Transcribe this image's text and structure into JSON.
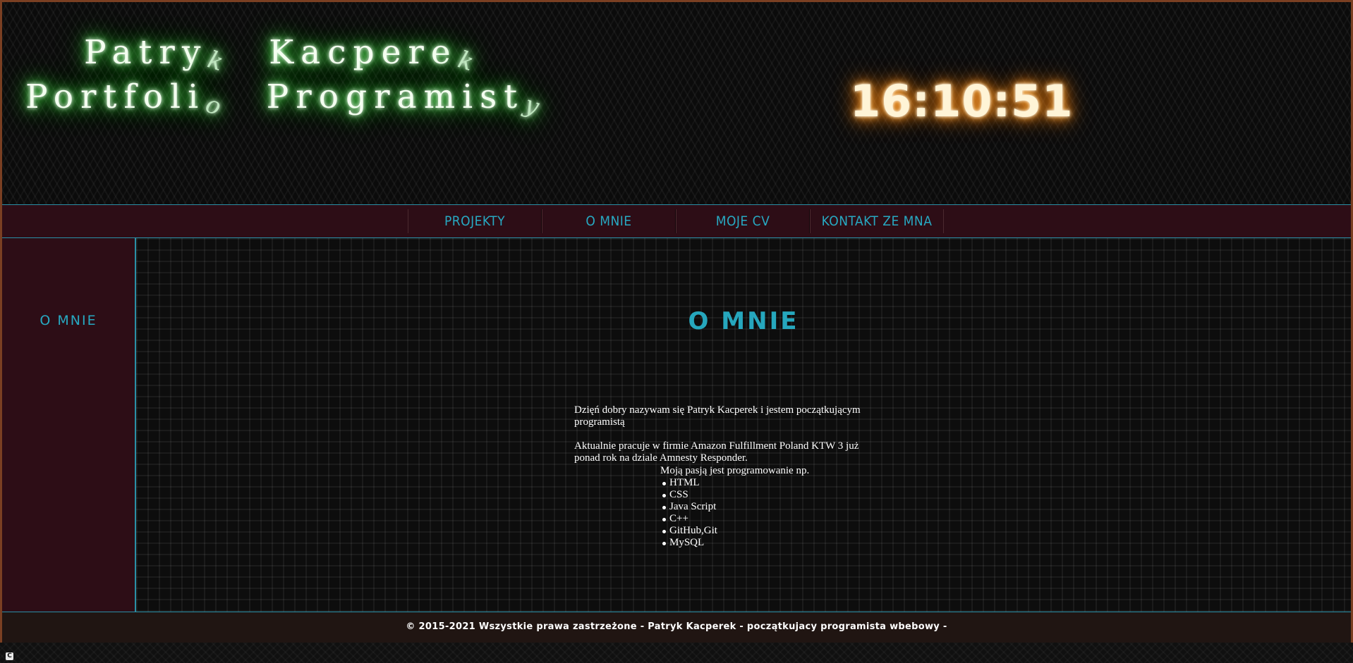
{
  "header": {
    "title_name": {
      "word1": "Patry",
      "word1_tail": "k",
      "word2": "Kacpere",
      "word2_tail": "k"
    },
    "title_role": {
      "word1": "Portfoli",
      "word1_tail": "o",
      "word2": "Programist",
      "word2_tail": "y"
    },
    "clock": "16:10:51"
  },
  "nav": {
    "items": [
      {
        "label": "PROJEKTY"
      },
      {
        "label": "O MNIE"
      },
      {
        "label": "MOJE CV"
      },
      {
        "label": "KONTAKT ZE MNA"
      }
    ]
  },
  "sidebar": {
    "item_label": "O MNIE"
  },
  "main": {
    "title": "O MNIE",
    "intro": [
      "Dzięń dobry nazywam się Patryk Kacperek i jestem początkującym programistą",
      "Aktualnie pracuje w firmie Amazon Fulfillment Poland KTW 3 już ponad rok na dziale Amnesty Responder."
    ],
    "skills_heading": "Moją pasją jest programowanie np.",
    "skills": [
      "HTML",
      "CSS",
      "Java Script",
      "C++",
      "GitHub,Git",
      "MySQL"
    ]
  },
  "footer": {
    "text": "© 2015-2021 Wszystkie prawa zastrzeżone - Patryk Kacperek - początkujacy programista wbebowy -"
  },
  "corner_icon": {
    "name": "extension-icon",
    "glyph": "C"
  },
  "colors": {
    "accent": "#27a9c2",
    "nav_background": "#2d0d16",
    "title_glow": "#2ee62e",
    "clock_glow": "#ff8c1a"
  }
}
